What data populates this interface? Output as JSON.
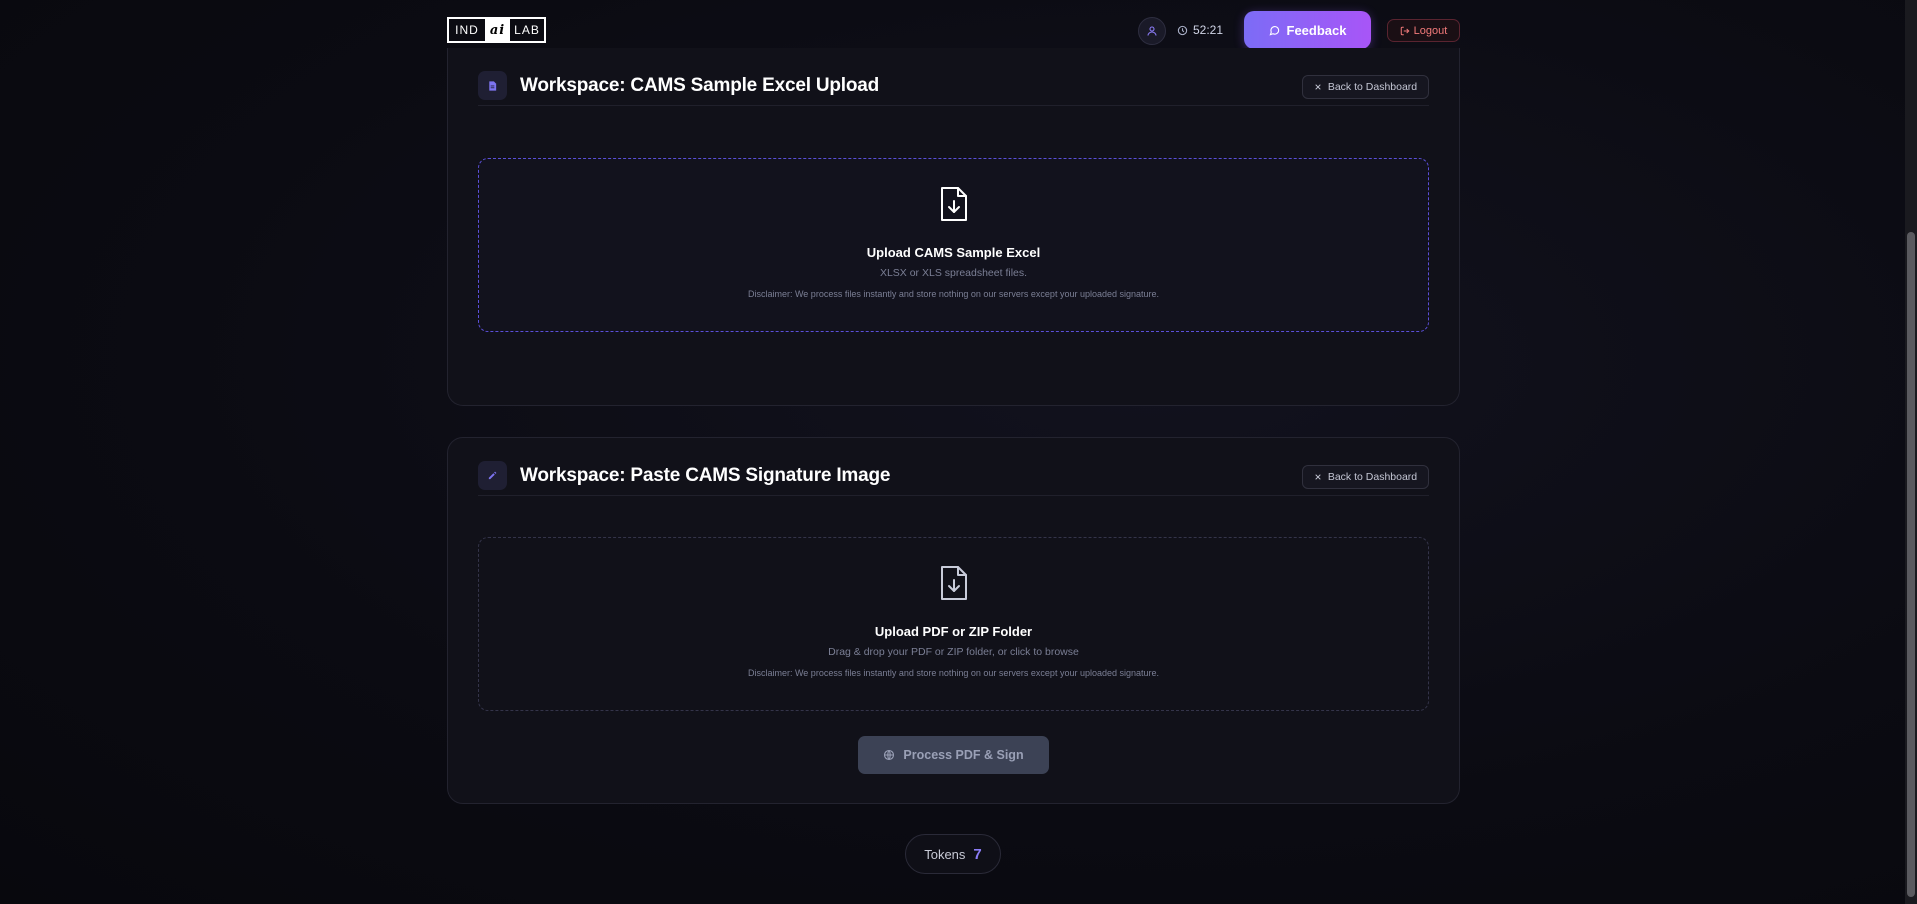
{
  "header": {
    "logo": [
      "IND",
      "ai",
      "LAB"
    ],
    "timer": "52:21",
    "feedback_label": "Feedback",
    "logout_label": "Logout"
  },
  "workspaces": [
    {
      "title": "Workspace: CAMS Sample Excel Upload",
      "back_label": "Back to Dashboard",
      "dropzone": {
        "title": "Upload CAMS Sample Excel",
        "subtitle": "XLSX or XLS spreadsheet files.",
        "disclaimer": "Disclaimer: We process files instantly and store nothing on our servers except your uploaded signature."
      }
    },
    {
      "title": "Workspace: Paste CAMS Signature Image",
      "back_label": "Back to Dashboard",
      "dropzone": {
        "title": "Upload PDF or ZIP Folder",
        "subtitle": "Drag & drop your PDF or ZIP folder, or click to browse",
        "disclaimer": "Disclaimer: We process files instantly and store nothing on our servers except your uploaded signature."
      },
      "action_label": "Process PDF & Sign"
    }
  ],
  "tokens": {
    "label": "Tokens",
    "count": "7"
  },
  "colors": {
    "accent": "#8b7cf6",
    "logout": "#f27a7a"
  }
}
